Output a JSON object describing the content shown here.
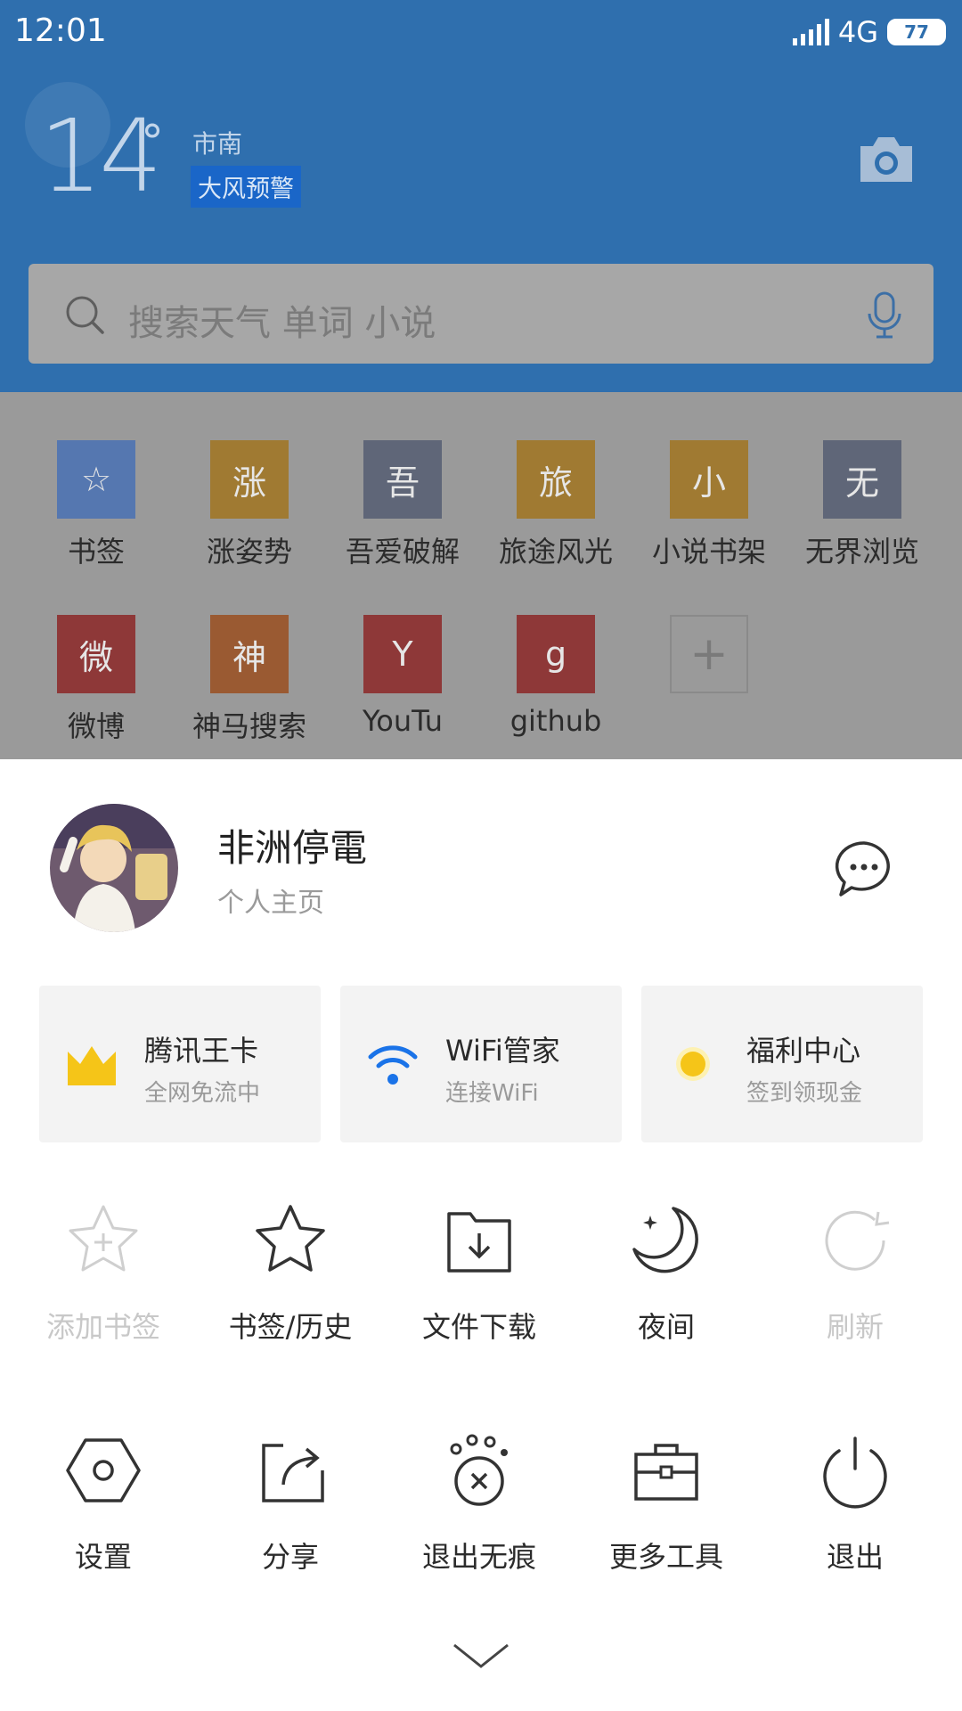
{
  "status_bar": {
    "time": "12:01",
    "network": "4G",
    "battery": "77"
  },
  "weather": {
    "temperature": "14",
    "degree_symbol": "°",
    "city": "市南",
    "alert": "大风预警"
  },
  "search": {
    "placeholder": "搜索天气 单词 小说"
  },
  "shortcuts": [
    {
      "label": "书签",
      "tile": "☆",
      "color": "#5577b0"
    },
    {
      "label": "涨姿势",
      "tile": "涨",
      "color": "#a07a32"
    },
    {
      "label": "吾爱破解",
      "tile": "吾",
      "color": "#5f6678"
    },
    {
      "label": "旅途风光",
      "tile": "旅",
      "color": "#a07a32"
    },
    {
      "label": "小说书架",
      "tile": "小",
      "color": "#a07a32"
    },
    {
      "label": "无界浏览",
      "tile": "无",
      "color": "#5f6678"
    },
    {
      "label": "微博",
      "tile": "微",
      "color": "#8e3838"
    },
    {
      "label": "神马搜索",
      "tile": "神",
      "color": "#9a5a32"
    },
    {
      "label": "YouTu",
      "tile": "Y",
      "color": "#8e3838"
    },
    {
      "label": "github",
      "tile": "g",
      "color": "#8e3838"
    }
  ],
  "add_shortcut": {
    "symbol": "+"
  },
  "profile": {
    "name": "非洲停電",
    "subtitle": "个人主页"
  },
  "cards": [
    {
      "title": "腾讯王卡",
      "subtitle": "全网免流中",
      "icon": "crown-icon",
      "color": "#f5c518"
    },
    {
      "title": "WiFi管家",
      "subtitle": "连接WiFi",
      "icon": "wifi-icon",
      "color": "#1a73e8"
    },
    {
      "title": "福利中心",
      "subtitle": "签到领现金",
      "icon": "coin-icon",
      "color": "#f5c518"
    }
  ],
  "tools_row1": [
    {
      "label": "添加书签",
      "icon": "add-bookmark-icon",
      "enabled": false
    },
    {
      "label": "书签/历史",
      "icon": "star-icon",
      "enabled": true
    },
    {
      "label": "文件下载",
      "icon": "download-folder-icon",
      "enabled": true
    },
    {
      "label": "夜间",
      "icon": "moon-icon",
      "enabled": true
    },
    {
      "label": "刷新",
      "icon": "refresh-icon",
      "enabled": false
    }
  ],
  "tools_row2": [
    {
      "label": "设置",
      "icon": "settings-icon",
      "enabled": true
    },
    {
      "label": "分享",
      "icon": "share-icon",
      "enabled": true
    },
    {
      "label": "退出无痕",
      "icon": "exit-incognito-icon",
      "enabled": true
    },
    {
      "label": "更多工具",
      "icon": "toolbox-icon",
      "enabled": true
    },
    {
      "label": "退出",
      "icon": "power-icon",
      "enabled": true
    }
  ]
}
